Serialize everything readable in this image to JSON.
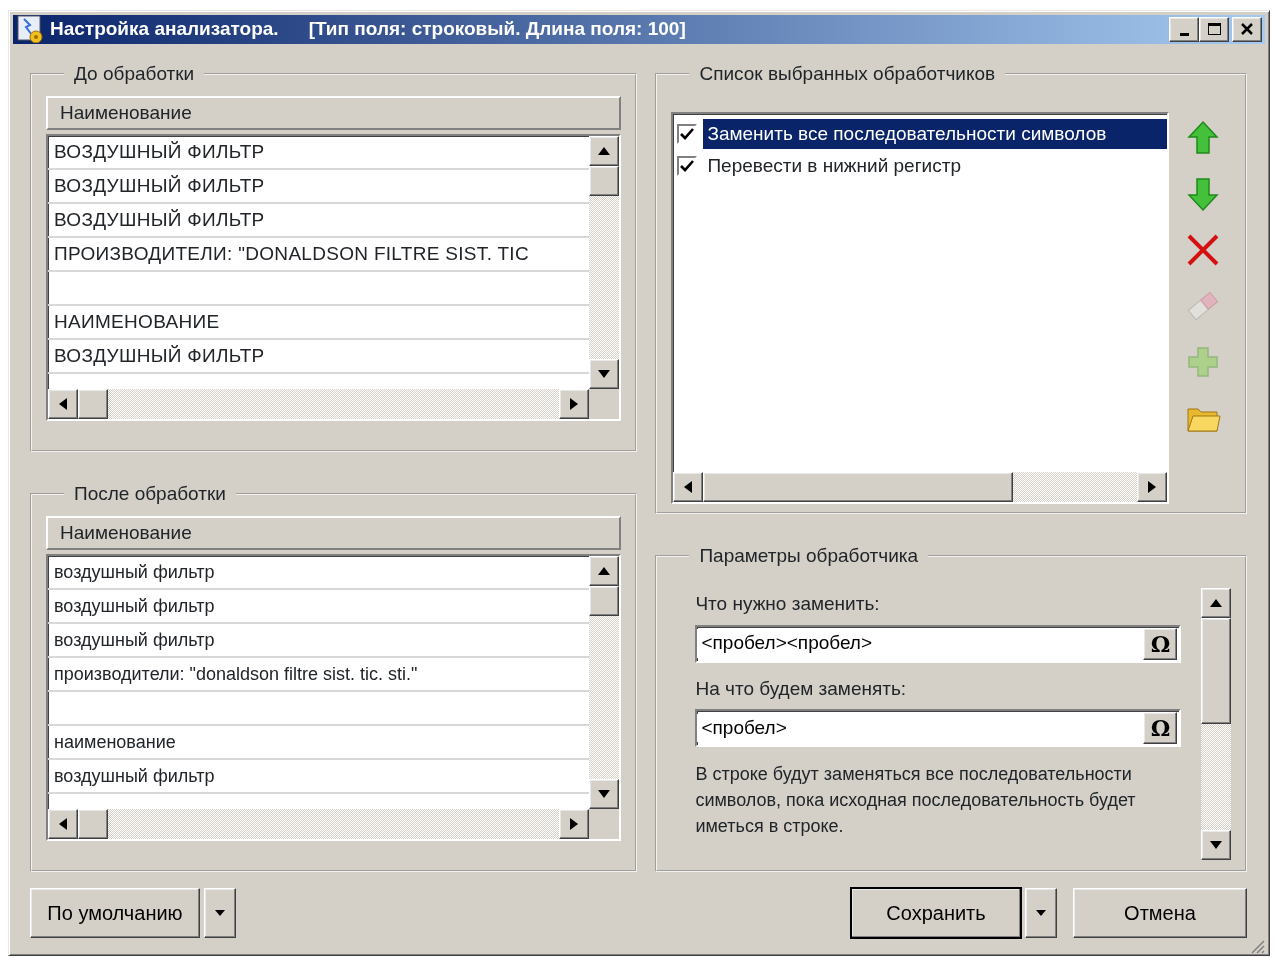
{
  "window": {
    "title": "Настройка анализатора.",
    "subtitle": "[Тип поля: строковый. Длина поля: 100]"
  },
  "before": {
    "title": "До обработки",
    "column": "Наименование",
    "rows": [
      {
        "text": "ВОЗДУШНЫЙ ФИЛЬТР"
      },
      {
        "text": "ВОЗДУШНЫЙ ФИЛЬТР"
      },
      {
        "text": "ВОЗДУШНЫЙ ФИЛЬТР"
      },
      {
        "text": "ПРОИЗВОДИТЕЛИ: \"DONALDSON FILTRE SIST. TIC"
      },
      {},
      {
        "text": "НАИМЕНОВАНИЕ"
      },
      {
        "text": "ВОЗДУШНЫЙ ФИЛЬТР"
      }
    ]
  },
  "after": {
    "title": "После обработки",
    "column": "Наименование",
    "rows": [
      {
        "text": "воздушный фильтр"
      },
      {
        "text": "воздушный фильтр"
      },
      {
        "text": "воздушный фильтр"
      },
      {
        "text": "производители: \"donaldson filtre sist. tic. sti.\""
      },
      {},
      {
        "text": "наименование"
      },
      {
        "text": "воздушный фильтр"
      }
    ]
  },
  "handlers": {
    "title": "Список выбранных обработчиков",
    "items": [
      {
        "label": "Заменить все последовательности символов",
        "checked": true,
        "selected": true
      },
      {
        "label": "Перевести в нижний регистр",
        "checked": true,
        "selected": false
      }
    ],
    "toolbar": [
      {
        "kind": "up",
        "disabled": false
      },
      {
        "kind": "down",
        "disabled": false
      },
      {
        "kind": "delete",
        "disabled": false
      },
      {
        "kind": "eraser",
        "disabled": true
      },
      {
        "kind": "add",
        "disabled": true
      },
      {
        "kind": "folder",
        "disabled": false
      }
    ]
  },
  "params": {
    "title": "Параметры обработчика",
    "fields": [
      {
        "label": "Что нужно заменить:",
        "value": "<пробел><пробел>",
        "button": "Ω"
      },
      {
        "label": "На что будем заменять:",
        "value": "<пробел>",
        "button": "Ω"
      }
    ],
    "description": "В строке будут заменяться все последовательности символов, пока исходная последовательность будет иметься в строке."
  },
  "buttons": {
    "default": "По умолчанию",
    "save": "Сохранить",
    "cancel": "Отмена"
  }
}
